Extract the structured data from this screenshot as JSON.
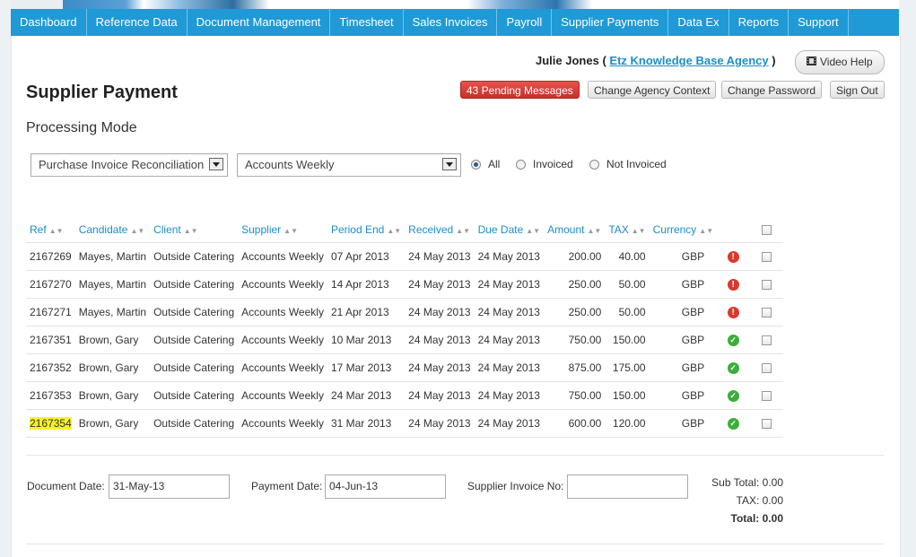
{
  "nav": [
    "Dashboard",
    "Reference Data",
    "Document Management",
    "Timesheet",
    "Sales Invoices",
    "Payroll",
    "Supplier Payments",
    "Data Ex",
    "Reports",
    "Support"
  ],
  "header": {
    "user_name": "Julie Jones",
    "paren_open": "(",
    "agency": "Etz Knowledge Base Agency",
    "paren_close": ")",
    "video_help": "Video Help",
    "pending_messages": "43 Pending Messages",
    "change_agency": "Change Agency Context",
    "change_password": "Change Password",
    "sign_out": "Sign Out"
  },
  "page": {
    "title": "Supplier Payment",
    "mode_title": "Processing Mode",
    "mode_select": "Purchase Invoice Reconciliation",
    "supplier_select": "Accounts Weekly",
    "filters": {
      "all": "All",
      "invoiced": "Invoiced",
      "not_invoiced": "Not Invoiced",
      "selected": "all"
    }
  },
  "table": {
    "columns": [
      "Ref",
      "Candidate",
      "Client",
      "Supplier",
      "Period End",
      "Received",
      "Due Date",
      "Amount",
      "TAX",
      "Currency"
    ],
    "rows": [
      {
        "ref": "2167269",
        "candidate": "Mayes, Martin",
        "client": "Outside Catering",
        "supplier": "Accounts Weekly",
        "period_end": "07 Apr 2013",
        "received": "24 May 2013",
        "due": "24 May 2013",
        "amount": "200.00",
        "tax": "40.00",
        "currency": "GBP",
        "status": "error"
      },
      {
        "ref": "2167270",
        "candidate": "Mayes, Martin",
        "client": "Outside Catering",
        "supplier": "Accounts Weekly",
        "period_end": "14 Apr 2013",
        "received": "24 May 2013",
        "due": "24 May 2013",
        "amount": "250.00",
        "tax": "50.00",
        "currency": "GBP",
        "status": "error"
      },
      {
        "ref": "2167271",
        "candidate": "Mayes, Martin",
        "client": "Outside Catering",
        "supplier": "Accounts Weekly",
        "period_end": "21 Apr 2013",
        "received": "24 May 2013",
        "due": "24 May 2013",
        "amount": "250.00",
        "tax": "50.00",
        "currency": "GBP",
        "status": "error"
      },
      {
        "ref": "2167351",
        "candidate": "Brown, Gary",
        "client": "Outside Catering",
        "supplier": "Accounts Weekly",
        "period_end": "10 Mar 2013",
        "received": "24 May 2013",
        "due": "24 May 2013",
        "amount": "750.00",
        "tax": "150.00",
        "currency": "GBP",
        "status": "ok"
      },
      {
        "ref": "2167352",
        "candidate": "Brown, Gary",
        "client": "Outside Catering",
        "supplier": "Accounts Weekly",
        "period_end": "17 Mar 2013",
        "received": "24 May 2013",
        "due": "24 May 2013",
        "amount": "875.00",
        "tax": "175.00",
        "currency": "GBP",
        "status": "ok"
      },
      {
        "ref": "2167353",
        "candidate": "Brown, Gary",
        "client": "Outside Catering",
        "supplier": "Accounts Weekly",
        "period_end": "24 Mar 2013",
        "received": "24 May 2013",
        "due": "24 May 2013",
        "amount": "750.00",
        "tax": "150.00",
        "currency": "GBP",
        "status": "ok"
      },
      {
        "ref": "2167354",
        "candidate": "Brown, Gary",
        "client": "Outside Catering",
        "supplier": "Accounts Weekly",
        "period_end": "31 Mar 2013",
        "received": "24 May 2013",
        "due": "24 May 2013",
        "amount": "600.00",
        "tax": "120.00",
        "currency": "GBP",
        "status": "ok",
        "highlight": true
      }
    ]
  },
  "footer": {
    "document_date_label": "Document Date:",
    "document_date": "31-May-13",
    "payment_date_label": "Payment Date:",
    "payment_date": "04-Jun-13",
    "supplier_invoice_label": "Supplier Invoice No:",
    "supplier_invoice": "",
    "sub_total": "Sub Total: 0.00",
    "tax_total": "TAX: 0.00",
    "total": "Total: 0.00"
  },
  "colors": {
    "nav_bg": "#1f9ad6",
    "link": "#1a8ec9",
    "danger": "#d9392f",
    "ok": "#3cae3a",
    "highlight": "#f6f22a"
  },
  "icons": {
    "video": "film-icon",
    "error": "error-icon",
    "ok": "check-icon",
    "sort": "sort-icon",
    "dropdown": "chevron-down-icon"
  }
}
